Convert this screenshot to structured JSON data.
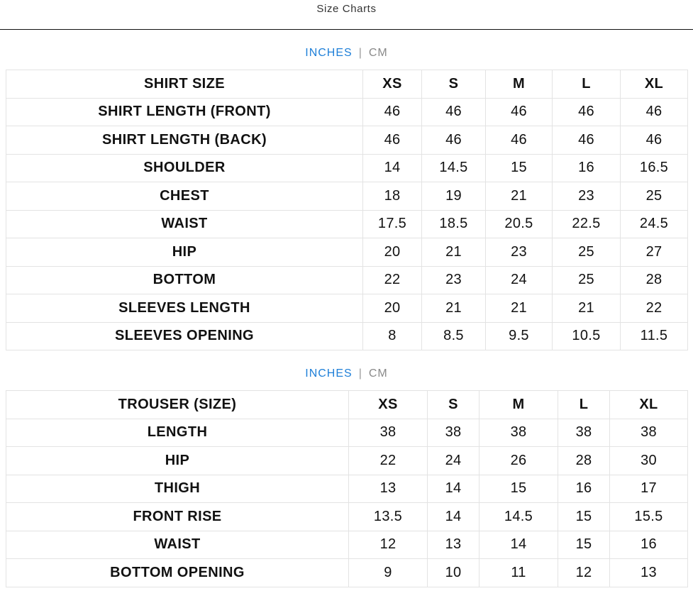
{
  "modal": {
    "title": "Size Charts"
  },
  "colors": {
    "active_unit": "#1e7fd8",
    "inactive_unit": "#8a8a8a",
    "cell_border": "#e3e3e3",
    "header_rule": "#111111"
  },
  "shirt_chart": {
    "unit_toggle": {
      "inches_label": "INCHES",
      "separator": "|",
      "cm_label": "CM",
      "selected": "INCHES"
    },
    "columns": [
      "SHIRT SIZE",
      "XS",
      "S",
      "M",
      "L",
      "XL"
    ],
    "rows": [
      {
        "label": "SHIRT LENGTH (FRONT)",
        "values": [
          "46",
          "46",
          "46",
          "46",
          "46"
        ]
      },
      {
        "label": "SHIRT LENGTH (BACK)",
        "values": [
          "46",
          "46",
          "46",
          "46",
          "46"
        ]
      },
      {
        "label": "SHOULDER",
        "values": [
          "14",
          "14.5",
          "15",
          "16",
          "16.5"
        ]
      },
      {
        "label": "CHEST",
        "values": [
          "18",
          "19",
          "21",
          "23",
          "25"
        ]
      },
      {
        "label": "WAIST",
        "values": [
          "17.5",
          "18.5",
          "20.5",
          "22.5",
          "24.5"
        ]
      },
      {
        "label": "HIP",
        "values": [
          "20",
          "21",
          "23",
          "25",
          "27"
        ]
      },
      {
        "label": "BOTTOM",
        "values": [
          "22",
          "23",
          "24",
          "25",
          "28"
        ]
      },
      {
        "label": "SLEEVES LENGTH",
        "values": [
          "20",
          "21",
          "21",
          "21",
          "22"
        ]
      },
      {
        "label": "SLEEVES OPENING",
        "values": [
          "8",
          "8.5",
          "9.5",
          "10.5",
          "11.5"
        ]
      }
    ]
  },
  "trouser_chart": {
    "unit_toggle": {
      "inches_label": "INCHES",
      "separator": "|",
      "cm_label": "CM",
      "selected": "INCHES"
    },
    "columns": [
      "TROUSER (SIZE)",
      "XS",
      "S",
      "M",
      "L",
      "XL"
    ],
    "rows": [
      {
        "label": "LENGTH",
        "values": [
          "38",
          "38",
          "38",
          "38",
          "38"
        ]
      },
      {
        "label": "HIP",
        "values": [
          "22",
          "24",
          "26",
          "28",
          "30"
        ]
      },
      {
        "label": "THIGH",
        "values": [
          "13",
          "14",
          "15",
          "16",
          "17"
        ]
      },
      {
        "label": "FRONT RISE",
        "values": [
          "13.5",
          "14",
          "14.5",
          "15",
          "15.5"
        ]
      },
      {
        "label": "WAIST",
        "values": [
          "12",
          "13",
          "14",
          "15",
          "16"
        ]
      },
      {
        "label": "BOTTOM OPENING",
        "values": [
          "9",
          "10",
          "11",
          "12",
          "13"
        ]
      }
    ]
  }
}
